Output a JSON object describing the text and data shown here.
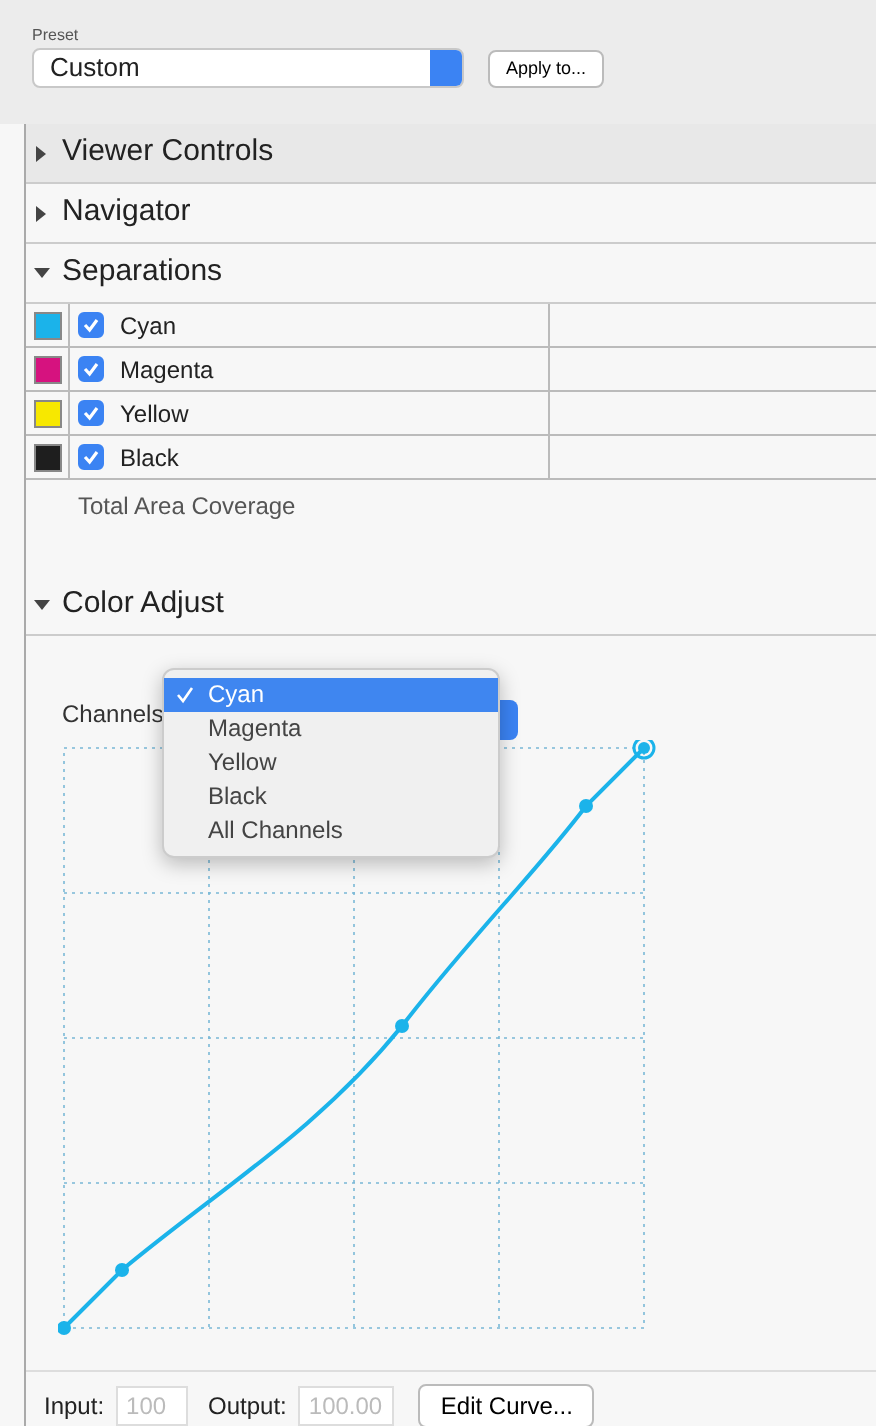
{
  "preset": {
    "label": "Preset",
    "value": "Custom",
    "apply_button": "Apply to..."
  },
  "sections": [
    {
      "title": "Viewer Controls",
      "expanded": false,
      "highlighted": true
    },
    {
      "title": "Navigator",
      "expanded": false,
      "highlighted": false
    },
    {
      "title": "Separations",
      "expanded": true,
      "highlighted": false
    }
  ],
  "separations": [
    {
      "name": "Cyan",
      "color": "#1bb3ea",
      "checked": true
    },
    {
      "name": "Magenta",
      "color": "#d6127f",
      "checked": true
    },
    {
      "name": "Yellow",
      "color": "#f7e800",
      "checked": true
    },
    {
      "name": "Black",
      "color": "#1e1e1e",
      "checked": true
    }
  ],
  "total_area_coverage": "Total Area Coverage",
  "color_adjust": {
    "title": "Color Adjust",
    "expanded": true,
    "channels_label": "Channels",
    "channel_menu": [
      {
        "label": "Cyan",
        "selected": true
      },
      {
        "label": "Magenta",
        "selected": false
      },
      {
        "label": "Yellow",
        "selected": false
      },
      {
        "label": "Black",
        "selected": false
      },
      {
        "label": "All Channels",
        "selected": false
      }
    ],
    "input_label": "Input:",
    "input_placeholder": "100",
    "output_label": "Output:",
    "output_placeholder": "100.00",
    "edit_button": "Edit Curve..."
  }
}
